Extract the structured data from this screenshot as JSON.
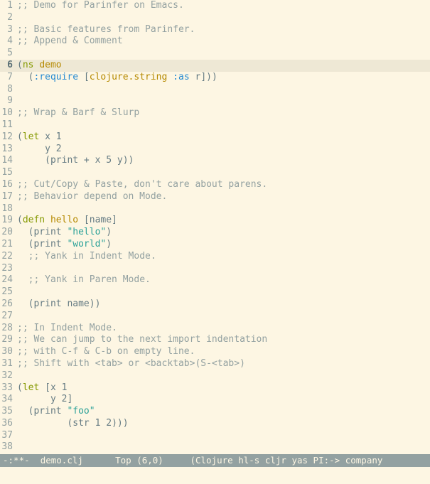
{
  "buffer": {
    "current_line": 6,
    "cursor": {
      "line": 6,
      "col": 0
    },
    "lines": [
      {
        "n": 1,
        "tokens": [
          {
            "c": "comment",
            "t": ";; Demo for Parinfer on Emacs."
          }
        ]
      },
      {
        "n": 2,
        "tokens": []
      },
      {
        "n": 3,
        "tokens": [
          {
            "c": "comment",
            "t": ";; Basic features from Parinfer."
          }
        ]
      },
      {
        "n": 4,
        "tokens": [
          {
            "c": "comment",
            "t": ";; Append & Comment"
          }
        ]
      },
      {
        "n": 5,
        "tokens": []
      },
      {
        "n": 6,
        "tokens": [
          {
            "c": "paren",
            "t": "("
          },
          {
            "c": "keyword",
            "t": "ns"
          },
          {
            "c": "plain",
            "t": " "
          },
          {
            "c": "def",
            "t": "demo"
          }
        ]
      },
      {
        "n": 7,
        "tokens": [
          {
            "c": "plain",
            "t": "  "
          },
          {
            "c": "paren",
            "t": "("
          },
          {
            "c": "builtin",
            "t": ":require"
          },
          {
            "c": "plain",
            "t": " "
          },
          {
            "c": "paren",
            "t": "["
          },
          {
            "c": "def",
            "t": "clojure.string"
          },
          {
            "c": "plain",
            "t": " "
          },
          {
            "c": "builtin",
            "t": ":as"
          },
          {
            "c": "plain",
            "t": " r"
          },
          {
            "c": "paren",
            "t": "]))"
          }
        ]
      },
      {
        "n": 8,
        "tokens": []
      },
      {
        "n": 9,
        "tokens": []
      },
      {
        "n": 10,
        "tokens": [
          {
            "c": "comment",
            "t": ";; Wrap & Barf & Slurp"
          }
        ]
      },
      {
        "n": 11,
        "tokens": []
      },
      {
        "n": 12,
        "tokens": [
          {
            "c": "paren",
            "t": "("
          },
          {
            "c": "keyword",
            "t": "let"
          },
          {
            "c": "plain",
            "t": " x 1"
          }
        ]
      },
      {
        "n": 13,
        "tokens": [
          {
            "c": "plain",
            "t": "     y 2"
          }
        ]
      },
      {
        "n": 14,
        "tokens": [
          {
            "c": "plain",
            "t": "     "
          },
          {
            "c": "paren",
            "t": "("
          },
          {
            "c": "plain",
            "t": "print + x 5 y"
          },
          {
            "c": "paren",
            "t": "))"
          }
        ]
      },
      {
        "n": 15,
        "tokens": []
      },
      {
        "n": 16,
        "tokens": [
          {
            "c": "comment",
            "t": ";; Cut/Copy & Paste, don't care about parens."
          }
        ]
      },
      {
        "n": 17,
        "tokens": [
          {
            "c": "comment",
            "t": ";; Behavior depend on Mode."
          }
        ]
      },
      {
        "n": 18,
        "tokens": []
      },
      {
        "n": 19,
        "tokens": [
          {
            "c": "paren",
            "t": "("
          },
          {
            "c": "keyword",
            "t": "defn"
          },
          {
            "c": "plain",
            "t": " "
          },
          {
            "c": "def",
            "t": "hello"
          },
          {
            "c": "plain",
            "t": " "
          },
          {
            "c": "paren",
            "t": "["
          },
          {
            "c": "plain",
            "t": "name"
          },
          {
            "c": "paren",
            "t": "]"
          }
        ]
      },
      {
        "n": 20,
        "tokens": [
          {
            "c": "plain",
            "t": "  "
          },
          {
            "c": "paren",
            "t": "("
          },
          {
            "c": "plain",
            "t": "print "
          },
          {
            "c": "str",
            "t": "\"hello\""
          },
          {
            "c": "paren",
            "t": ")"
          }
        ]
      },
      {
        "n": 21,
        "tokens": [
          {
            "c": "plain",
            "t": "  "
          },
          {
            "c": "paren",
            "t": "("
          },
          {
            "c": "plain",
            "t": "print "
          },
          {
            "c": "str",
            "t": "\"world\""
          },
          {
            "c": "paren",
            "t": ")"
          }
        ]
      },
      {
        "n": 22,
        "tokens": [
          {
            "c": "plain",
            "t": "  "
          },
          {
            "c": "comment",
            "t": ";; Yank in Indent Mode."
          }
        ]
      },
      {
        "n": 23,
        "tokens": []
      },
      {
        "n": 24,
        "tokens": [
          {
            "c": "plain",
            "t": "  "
          },
          {
            "c": "comment",
            "t": ";; Yank in Paren Mode."
          }
        ]
      },
      {
        "n": 25,
        "tokens": []
      },
      {
        "n": 26,
        "tokens": [
          {
            "c": "plain",
            "t": "  "
          },
          {
            "c": "paren",
            "t": "("
          },
          {
            "c": "plain",
            "t": "print name"
          },
          {
            "c": "paren",
            "t": "))"
          }
        ]
      },
      {
        "n": 27,
        "tokens": []
      },
      {
        "n": 28,
        "tokens": [
          {
            "c": "comment",
            "t": ";; In Indent Mode."
          }
        ]
      },
      {
        "n": 29,
        "tokens": [
          {
            "c": "comment",
            "t": ";; We can jump to the next import indentation"
          }
        ]
      },
      {
        "n": 30,
        "tokens": [
          {
            "c": "comment",
            "t": ";; with C-f & C-b on empty line."
          }
        ]
      },
      {
        "n": 31,
        "tokens": [
          {
            "c": "comment",
            "t": ";; Shift with <tab> or <backtab>(S-<tab>)"
          }
        ]
      },
      {
        "n": 32,
        "tokens": []
      },
      {
        "n": 33,
        "tokens": [
          {
            "c": "paren",
            "t": "("
          },
          {
            "c": "keyword",
            "t": "let"
          },
          {
            "c": "plain",
            "t": " "
          },
          {
            "c": "paren",
            "t": "["
          },
          {
            "c": "plain",
            "t": "x 1"
          }
        ]
      },
      {
        "n": 34,
        "tokens": [
          {
            "c": "plain",
            "t": "      y 2"
          },
          {
            "c": "paren",
            "t": "]"
          }
        ]
      },
      {
        "n": 35,
        "tokens": [
          {
            "c": "plain",
            "t": "  "
          },
          {
            "c": "paren",
            "t": "("
          },
          {
            "c": "plain",
            "t": "print "
          },
          {
            "c": "str",
            "t": "\"foo\""
          }
        ]
      },
      {
        "n": 36,
        "tokens": [
          {
            "c": "plain",
            "t": "         "
          },
          {
            "c": "paren",
            "t": "("
          },
          {
            "c": "plain",
            "t": "str 1 2"
          },
          {
            "c": "paren",
            "t": ")))"
          }
        ]
      },
      {
        "n": 37,
        "tokens": []
      },
      {
        "n": 38,
        "tokens": []
      }
    ]
  },
  "modeline": {
    "modified": "-:**-",
    "filename": "demo.clj",
    "position": "Top",
    "cursor_display": "(6,0)",
    "modes": "(Clojure hl-s cljr yas PI:-> company "
  },
  "colors": {
    "bg": "#fdf6e3",
    "fg": "#657b83",
    "highlight": "#eee8d5",
    "modeline_bg": "#93a1a1",
    "modeline_fg": "#fdf6e3"
  }
}
